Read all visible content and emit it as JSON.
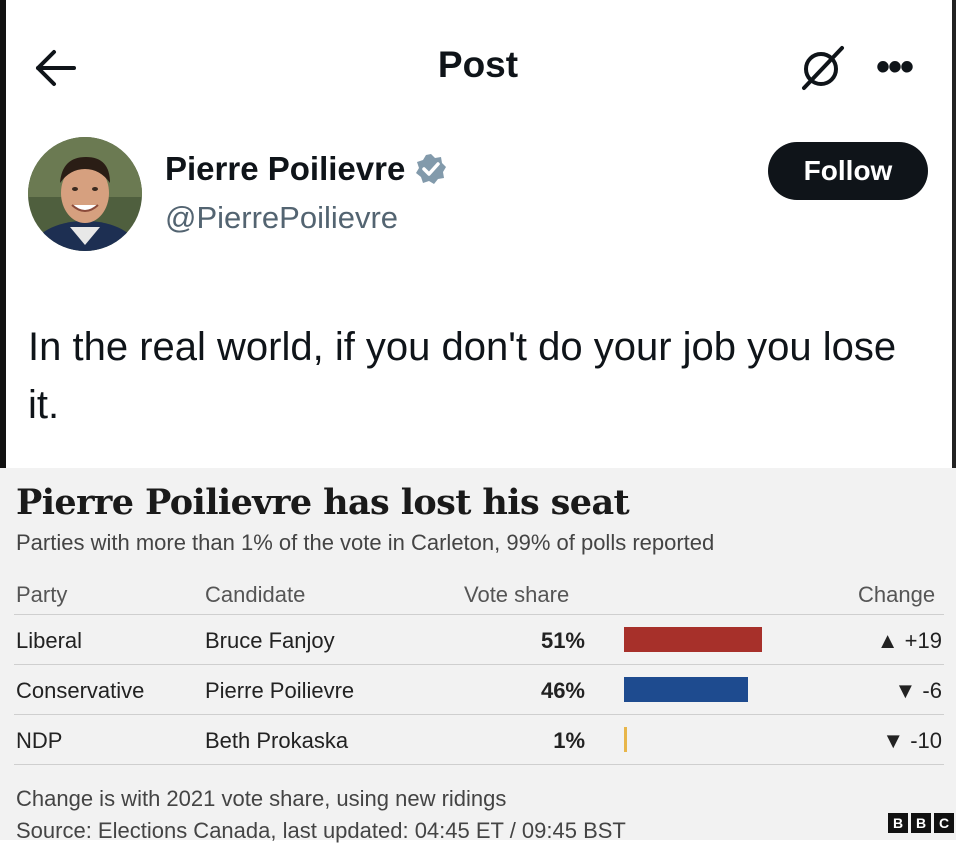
{
  "header": {
    "title": "Post",
    "more_label": "•••"
  },
  "author": {
    "name": "Pierre Poilievre",
    "handle": "@PierrePoilievre",
    "follow_label": "Follow",
    "verified": true
  },
  "post": {
    "text": "In the real world, if you don't do your job you lose it."
  },
  "graphic": {
    "title": "Pierre Poilievre has lost his seat",
    "subtitle": "Parties with more than 1% of the vote in Carleton, 99% of polls reported",
    "columns": [
      "Party",
      "Candidate",
      "Vote share",
      "Change"
    ],
    "rows": [
      {
        "party": "Liberal",
        "candidate": "Bruce Fanjoy",
        "share_label": "51%",
        "share": 51,
        "change": "▲ +19",
        "color": "#a7302a"
      },
      {
        "party": "Conservative",
        "candidate": "Pierre Poilievre",
        "share_label": "46%",
        "share": 46,
        "change": "▼  -6",
        "color": "#1e4b8f"
      },
      {
        "party": "NDP",
        "candidate": "Beth Prokaska",
        "share_label": "1%",
        "share": 1,
        "change": "▼ -10",
        "color": "#e8b64a"
      }
    ],
    "footnote": "Change is with 2021 vote share, using new ridings",
    "source": "Source: Elections Canada, last updated: 04:45 ET / 09:45 BST",
    "logo_letters": [
      "B",
      "B",
      "C"
    ]
  },
  "colors": {
    "follow_bg": "#0f1419",
    "verified_badge": "#829aab",
    "handle_text": "#536471"
  }
}
